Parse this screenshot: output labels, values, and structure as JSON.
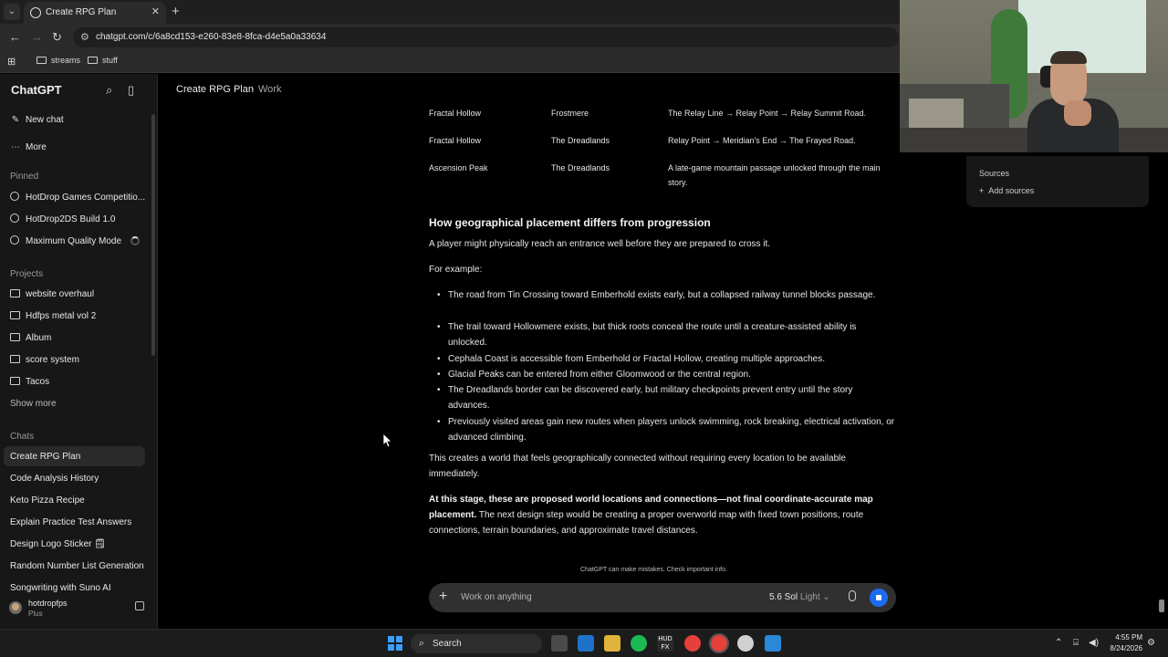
{
  "browser": {
    "tab_title": "Create RPG Plan",
    "url": "chatgpt.com/c/6a8cd153-e260-83e8-8fca-d4e5a0a33634",
    "bookmarks": [
      "streams",
      "stuff"
    ]
  },
  "sidebar": {
    "brand": "ChatGPT",
    "new_chat": "New chat",
    "more": "More",
    "pinned_label": "Pinned",
    "pinned": [
      "HotDrop Games Competitio...",
      "HotDrop2DS Build 1.0",
      "Maximum Quality Mode"
    ],
    "projects_label": "Projects",
    "projects": [
      "website overhaul",
      "Hdfps metal vol 2",
      "Album",
      "score system",
      "Tacos"
    ],
    "show_more": "Show more",
    "chats_label": "Chats",
    "chats": [
      "Create RPG Plan",
      "Code Analysis History",
      "Keto Pizza Recipe",
      "Explain Practice Test Answers",
      "Design Logo Sticker 🗒",
      "Random Number List Generation",
      "Songwriting with Suno AI"
    ],
    "user_name": "hotdropfps",
    "user_plan": "Plus"
  },
  "header": {
    "title": "Create RPG Plan",
    "separator": "·",
    "project": "Work"
  },
  "table": {
    "rows": [
      [
        "Fractal Hollow",
        "Frostmere",
        "The Relay Line → Relay Point → Relay Summit Road."
      ],
      [
        "Fractal Hollow",
        "The Dreadlands",
        "Relay Point → Meridian's End → The Frayed Road."
      ],
      [
        "Ascension Peak",
        "The Dreadlands",
        "A late-game mountain passage unlocked through the main story."
      ]
    ]
  },
  "content": {
    "heading": "How geographical placement differs from progression",
    "intro": "A player might physically reach an entrance well before they are prepared to cross it.",
    "example_label": "For example:",
    "bullets": [
      "The road from Tin Crossing toward Emberhold exists early, but a collapsed railway tunnel blocks passage.",
      "The trail toward Hollowmere exists, but thick roots conceal the route until a creature-assisted ability is unlocked.",
      "Cephala Coast is accessible from Emberhold or Fractal Hollow, creating multiple approaches.",
      "Glacial Peaks can be entered from either Gloomwood or the central region.",
      "The Dreadlands border can be discovered early, but military checkpoints prevent entry until the story advances.",
      "Previously visited areas gain new routes when players unlock swimming, rock breaking, electrical activation, or advanced climbing."
    ],
    "summary": "This creates a world that feels geographically connected without requiring every location to be available immediately.",
    "final_bold": "At this stage, these are proposed world locations and connections—not final coordinate-accurate map placement.",
    "final_rest": " The next design step would be creating a proper overworld map with fixed town positions, route connections, terrain boundaries, and approximate travel distances."
  },
  "composer": {
    "disclaimer": "ChatGPT can make mistakes. Check important info.",
    "placeholder": "Work on anything",
    "model": "5.6 Sol",
    "mode": "Light"
  },
  "sources_panel": {
    "heading": "Sources",
    "add": "Add sources"
  },
  "taskbar": {
    "search": "Search",
    "time": "4:55 PM",
    "date": "8/24/2026"
  },
  "colors": {
    "accent": "#1a6cf0",
    "sidebar_bg": "#171717",
    "main_bg": "#000000"
  }
}
